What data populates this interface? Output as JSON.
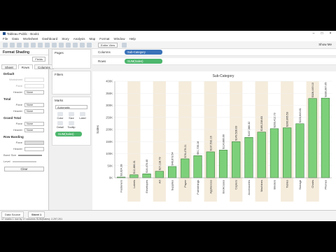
{
  "window": {
    "title": "Tableau Public - Book1"
  },
  "menu": [
    "File",
    "Data",
    "Worksheet",
    "Dashboard",
    "Story",
    "Analysis",
    "Map",
    "Format",
    "Window",
    "Help"
  ],
  "toolbar": {
    "view": "Entire View",
    "show_me": "Show Me"
  },
  "format_pane": {
    "title": "Format Shading",
    "fields_label": "Fields",
    "tabs": [
      "Sheet",
      "Rows",
      "Columns"
    ],
    "sections": {
      "default": "Default",
      "total": "Total",
      "grand_total": "Grand Total",
      "row_banding": "Row Banding"
    },
    "labels": {
      "worksheet": "Worksheet",
      "pane": "Pane",
      "header": "Header",
      "band_size": "Band Size",
      "level": "Level"
    },
    "none": "None",
    "clear": "Clear"
  },
  "cards": {
    "pages": "Pages",
    "filters": "Filters",
    "marks": "Marks",
    "marks_type": "Automatic",
    "buttons": [
      "Color",
      "Size",
      "Label",
      "Detail",
      "Tooltip"
    ],
    "pill": "SUM(Sales)"
  },
  "shelves": {
    "columns_label": "Columns",
    "columns_pill": "Sub-Category",
    "rows_label": "Rows",
    "rows_pill": "SUM(Sales)"
  },
  "status": {
    "data_source": "Data Source",
    "sheet": "Sheet 1",
    "text": "17 marks    1 row by 17 columns    SUM(Sales): 2,297,201"
  },
  "colors": {
    "bar": "#7dd07a",
    "bar_stroke": "#2f6b2e",
    "band": "#f5ecdc"
  },
  "chart_data": {
    "type": "bar",
    "title": "Sub-Category",
    "ylabel": "Sales",
    "ylim": [
      0,
      350000
    ],
    "yticks": [
      "0K",
      "50K",
      "100K",
      "150K",
      "200K",
      "250K",
      "300K",
      "350K",
      "400K"
    ],
    "categories": [
      "Fasteners",
      "Labels",
      "Envelopes",
      "Art",
      "Supplies",
      "Paper",
      "Furnishings",
      "Appliances",
      "Bookcases",
      "Copiers",
      "Accessories",
      "Machines",
      "Binders",
      "Tables",
      "Storage",
      "Chairs",
      "Phones"
    ],
    "values": [
      3024.28,
      12486.31,
      16476.4,
      27118.79,
      46673.54,
      78479.21,
      91705.16,
      107532.16,
      114880.0,
      149528.03,
      167380.32,
      189238.63,
      203412.73,
      206965.53,
      223843.61,
      328449.1,
      330007.05
    ],
    "data_labels": [
      "$3,024.28",
      "$12,486.31",
      "$16,476.40",
      "$27,118.79",
      "$46,673.54",
      "$78,479.21",
      "$91,705.16",
      "$107,532.16",
      "$114,880.00",
      "$149,528.03",
      "$167,380.32",
      "$189,238.63",
      "$203,412.73",
      "$206,965.53",
      "$223,843.61",
      "$328,449.10",
      "$330,007.05"
    ]
  }
}
